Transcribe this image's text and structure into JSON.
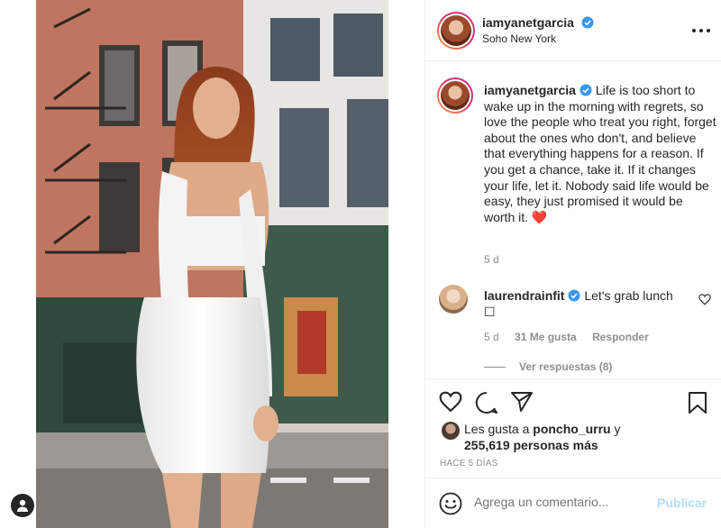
{
  "post": {
    "username": "iamyanetgarcia",
    "location": "Soho New York",
    "caption": "Life is too short to wake up in the morning with regrets, so love the people who treat you right, forget about the ones who don't, and believe that everything happens for a reason. If you get a chance, take it. If it changes your life, let it. Nobody said life would be easy, they just promised it would be worth it.",
    "caption_emoji": "❤️",
    "caption_age": "5 d"
  },
  "comment": {
    "username": "laurendrainfit",
    "text": "Let's grab lunch",
    "glyph": "☐",
    "age": "5 d",
    "likes": "31 Me gusta",
    "reply_label": "Responder",
    "view_replies": "Ver respuestas (8)"
  },
  "likes": {
    "prefix": "Les gusta a",
    "user": "poncho_urru",
    "suffix": "y",
    "others": "255,619 personas más"
  },
  "post_age": "HACE 5 DÍAS",
  "composer": {
    "placeholder": "Agrega un comentario...",
    "publish_label": "Publicar"
  },
  "colors": {
    "verified": "#3897f0",
    "heart": "#e0245e",
    "publish_disabled": "#b2dffc"
  }
}
